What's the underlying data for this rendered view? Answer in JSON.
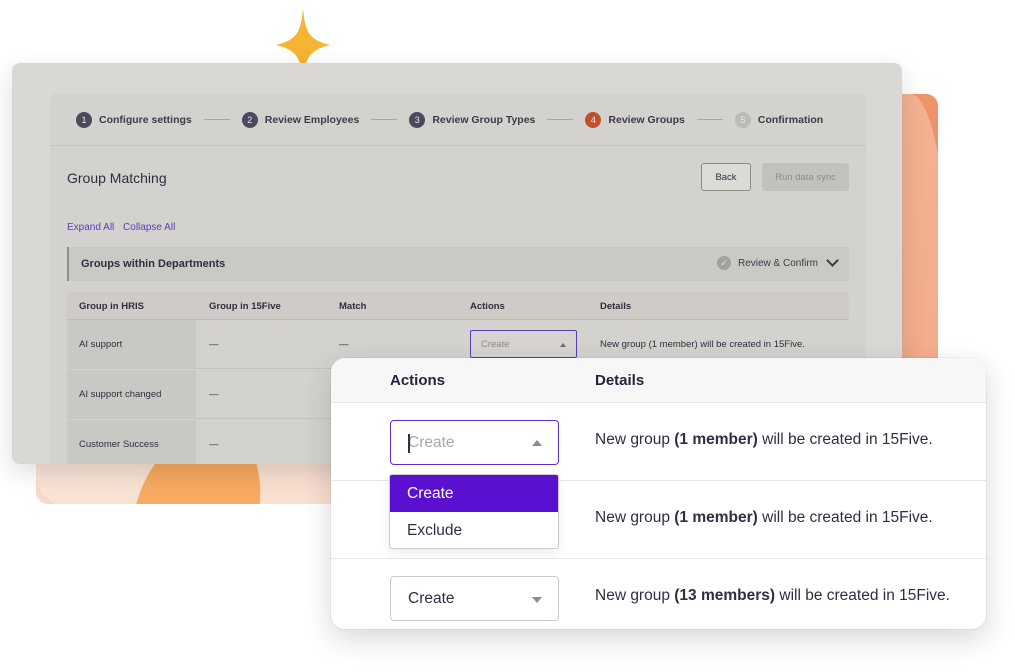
{
  "stepper": {
    "steps": [
      {
        "num": "1",
        "label": "Configure settings"
      },
      {
        "num": "2",
        "label": "Review Employees"
      },
      {
        "num": "3",
        "label": "Review Group Types"
      },
      {
        "num": "4",
        "label": "Review Groups"
      },
      {
        "num": "5",
        "label": "Confirmation"
      }
    ],
    "active_step": 4
  },
  "page": {
    "title": "Group Matching",
    "back_label": "Back",
    "run_sync_label": "Run data sync",
    "expand_all": "Expand All",
    "collapse_all": "Collapse All"
  },
  "section": {
    "title": "Groups within Departments",
    "review_confirm": "Review & Confirm"
  },
  "table": {
    "headers": [
      "Group in HRIS",
      "Group in 15Five",
      "Match",
      "Actions",
      "Details"
    ],
    "rows": [
      {
        "hris": "AI support",
        "group15five": "—",
        "match": "—",
        "action_placeholder": "Create",
        "details": "New group (1 member) will be created in 15Five."
      },
      {
        "hris": "AI support changed",
        "group15five": "—"
      },
      {
        "hris": "Customer Success",
        "group15five": "—"
      }
    ]
  },
  "zoom_card": {
    "headers": {
      "actions": "Actions",
      "details": "Details"
    },
    "rows": [
      {
        "select_value": "Create",
        "details_prefix": "New group ",
        "details_bold": "(1 member)",
        "details_suffix": " will be created in 15Five."
      },
      {
        "details_prefix": "New group ",
        "details_bold": "(1 member)",
        "details_suffix": " will be created in 15Five."
      },
      {
        "select_value": "Create",
        "details_prefix": "New group ",
        "details_bold": "(13 members)",
        "details_suffix": " will be created in 15Five."
      }
    ],
    "dropdown_options": [
      "Create",
      "Exclude"
    ],
    "dropdown_selected": "Create"
  },
  "colors": {
    "accent_purple": "#5b10d1",
    "active_step": "#c0502a",
    "sparkle": "#f5b433"
  },
  "icons": {
    "sparkle": "sparkle-star-icon",
    "check": "check-circle-icon",
    "chevron": "chevron-down-icon",
    "dropdown_up": "triangle-up-icon",
    "dropdown_down": "triangle-down-icon"
  }
}
